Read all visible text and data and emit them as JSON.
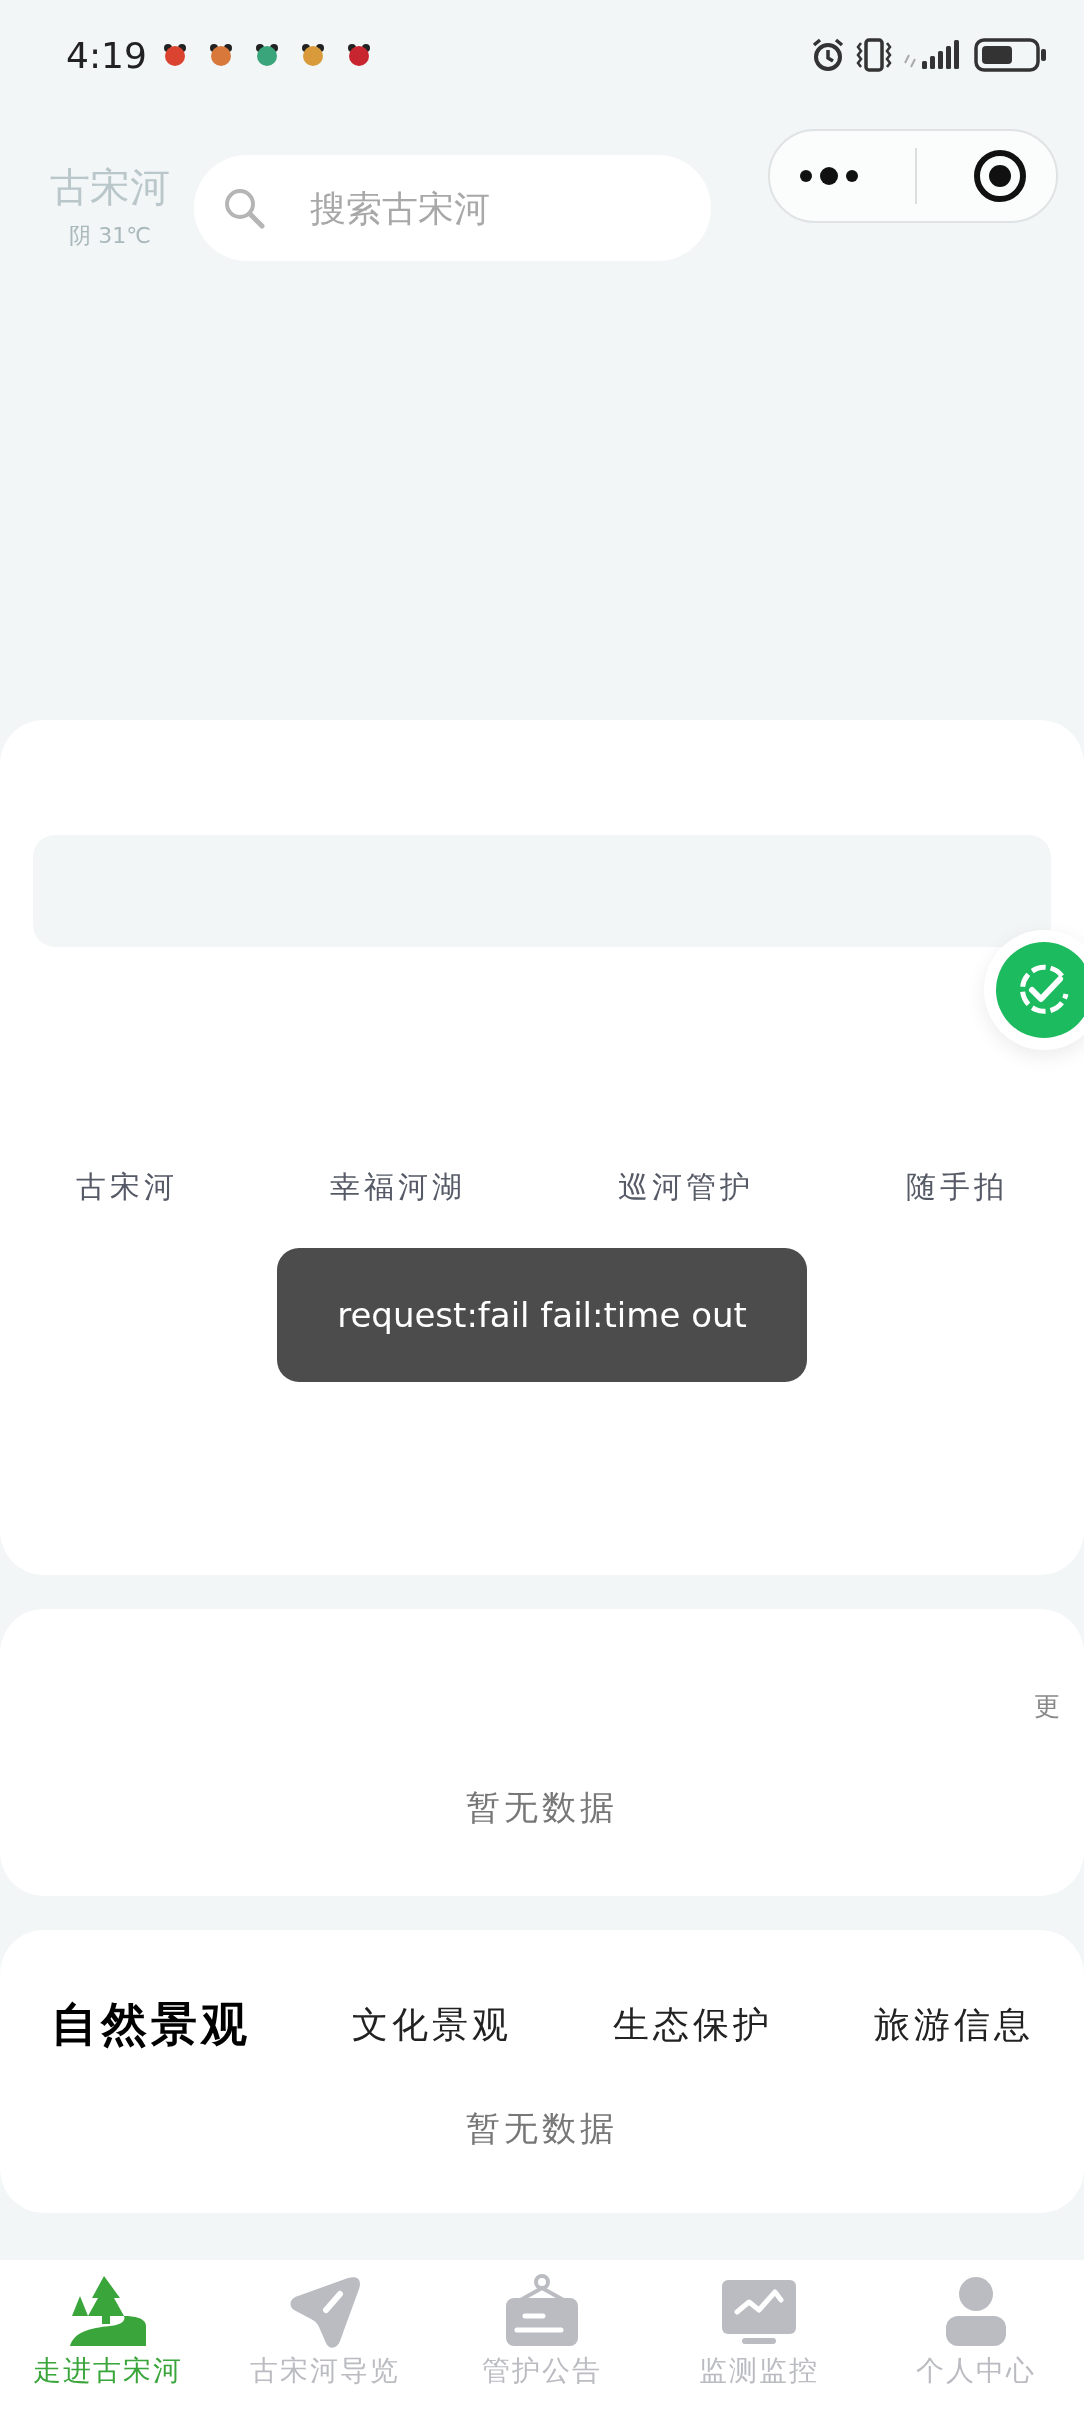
{
  "status_bar": {
    "time": "4:19"
  },
  "header": {
    "title": "古宋河",
    "weather": "阴 31℃",
    "search": {
      "placeholder": "搜索古宋河"
    }
  },
  "quick_links": [
    {
      "label": "古宋河"
    },
    {
      "label": "幸福河湖"
    },
    {
      "label": "巡河管护"
    },
    {
      "label": "随手拍"
    }
  ],
  "toast": {
    "text": "request:fail fail:time out"
  },
  "news_card": {
    "more": "更",
    "empty": "暂无数据"
  },
  "category_tabs": [
    {
      "label": "自然景观",
      "selected": true
    },
    {
      "label": "文化景观",
      "selected": false
    },
    {
      "label": "生态保护",
      "selected": false
    },
    {
      "label": "旅游信息",
      "selected": false
    }
  ],
  "category_empty": "暂无数据",
  "tab_bar": [
    {
      "label": "走进古宋河",
      "kind": "forest",
      "selected": true
    },
    {
      "label": "古宋河导览",
      "kind": "navigate",
      "selected": false
    },
    {
      "label": "管护公告",
      "kind": "notice",
      "selected": false
    },
    {
      "label": "监测监控",
      "kind": "monitor",
      "selected": false
    },
    {
      "label": "个人中心",
      "kind": "user",
      "selected": false
    }
  ]
}
